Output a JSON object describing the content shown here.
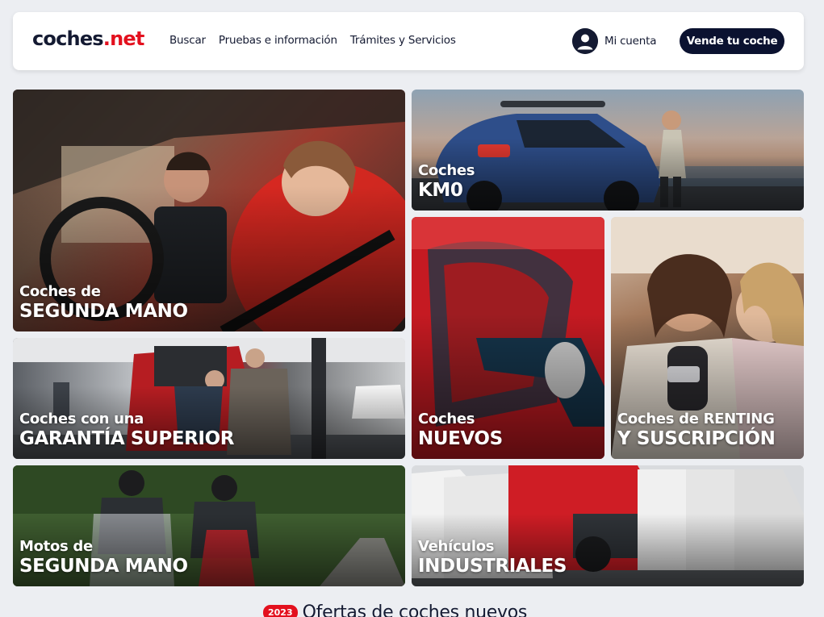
{
  "header": {
    "logo_main": "coches",
    "logo_dot": ".",
    "logo_net": "net",
    "nav": [
      "Buscar",
      "Pruebas e información",
      "Trámites y Servicios"
    ],
    "account_label": "Mi cuenta",
    "sell_button": "Vende tu coche"
  },
  "tiles": [
    {
      "line1": "Coches de",
      "line2": "SEGUNDA MANO"
    },
    {
      "line1": "Coches",
      "line2": "KM0"
    },
    {
      "line1": "Coches con una",
      "line2": "GARANTÍA SUPERIOR"
    },
    {
      "line1": "Coches",
      "line2": "NUEVOS"
    },
    {
      "line1": "Coches de RENTING",
      "line2": "Y SUSCRIPCIÓN"
    },
    {
      "line1": "Motos de",
      "line2": "SEGUNDA MANO"
    },
    {
      "line1": "Vehículos",
      "line2": "INDUSTRIALES"
    }
  ],
  "offers": {
    "year_badge": "2023",
    "title": "Ofertas de coches nuevos"
  },
  "colors": {
    "brand_red": "#e3101e",
    "brand_navy": "#0b1230",
    "background": "#eceef2"
  },
  "icons": {
    "account": "user-circle-icon"
  }
}
